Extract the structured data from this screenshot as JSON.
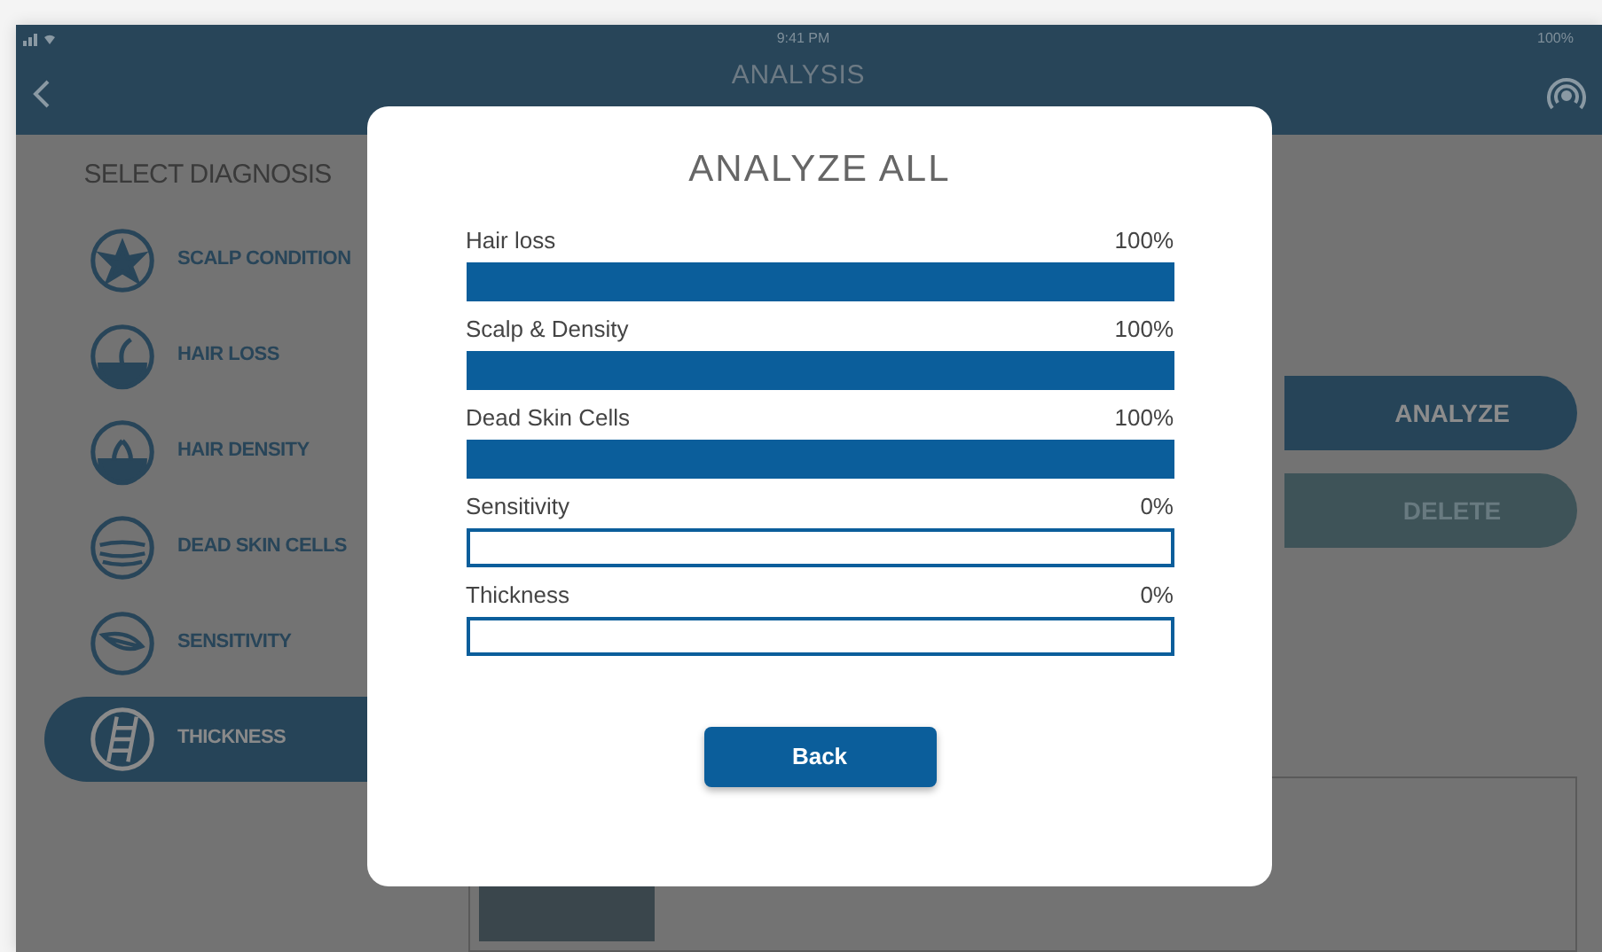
{
  "status_bar": {
    "time": "9:41 PM",
    "battery": "100%"
  },
  "header": {
    "title": "ANALYSIS"
  },
  "sidebar": {
    "title": "SELECT DIAGNOSIS",
    "items": [
      {
        "label": "SCALP CONDITION",
        "selected": false
      },
      {
        "label": "HAIR LOSS",
        "selected": false
      },
      {
        "label": "HAIR DENSITY",
        "selected": false
      },
      {
        "label": "DEAD SKIN CELLS",
        "selected": false
      },
      {
        "label": "SENSITIVITY",
        "selected": false
      },
      {
        "label": "THICKNESS",
        "selected": true
      }
    ]
  },
  "actions": [
    {
      "label": "ANALYZE",
      "kind": "primary"
    },
    {
      "label": "DELETE",
      "kind": "secondary"
    }
  ],
  "dialog": {
    "title": "ANALYZE ALL",
    "rows": [
      {
        "label": "Hair loss",
        "reading": "100%",
        "level": 1
      },
      {
        "label": "Scalp & Density",
        "reading": "100%",
        "level": 1
      },
      {
        "label": "Dead Skin Cells",
        "reading": "100%",
        "level": 1
      },
      {
        "label": "Sensitivity",
        "reading": "0%",
        "level": 0
      },
      {
        "label": "Thickness",
        "reading": "0%",
        "level": 0
      }
    ],
    "button": "Back"
  }
}
